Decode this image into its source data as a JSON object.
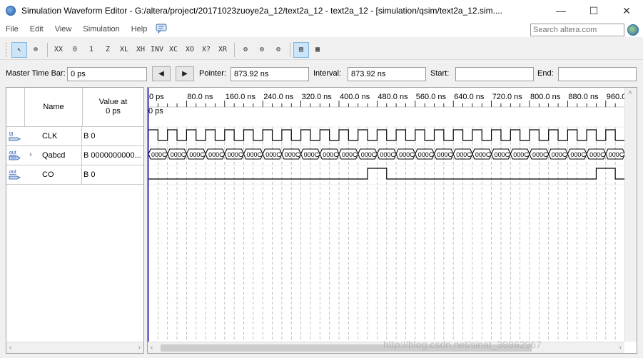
{
  "window": {
    "title": "Simulation Waveform Editor - G:/altera/project/20171023zuoye2a_12/text2a_12 - text2a_12 - [simulation/qsim/text2a_12.sim....",
    "minimize": "—",
    "maximize": "☐",
    "close": "✕"
  },
  "menu": {
    "items": [
      {
        "label": "File"
      },
      {
        "label": "Edit"
      },
      {
        "label": "View"
      },
      {
        "label": "Simulation"
      },
      {
        "label": "Help"
      }
    ],
    "help_icon": "speech-bubble-icon",
    "search_placeholder": "Search altera.com"
  },
  "toolbar": {
    "tools": [
      {
        "name": "select-tool",
        "glyph": "↖",
        "active": true
      },
      {
        "name": "zoom-tool",
        "glyph": "⊕",
        "active": false
      },
      {
        "name": "uninitialized-tool",
        "glyph": "XX",
        "active": false
      },
      {
        "name": "forcing-low-tool",
        "glyph": "0",
        "active": false
      },
      {
        "name": "forcing-high-tool",
        "glyph": "1",
        "active": false
      },
      {
        "name": "high-impedance-tool",
        "glyph": "Z",
        "active": false
      },
      {
        "name": "weak-low-tool",
        "glyph": "XL",
        "active": false
      },
      {
        "name": "weak-high-tool",
        "glyph": "XH",
        "active": false
      },
      {
        "name": "invert-tool",
        "glyph": "INV",
        "active": false
      },
      {
        "name": "count-value-tool",
        "glyph": "XC",
        "active": false
      },
      {
        "name": "clock-tool",
        "glyph": "XO",
        "active": false
      },
      {
        "name": "arbitrary-value-tool",
        "glyph": "X?",
        "active": false
      },
      {
        "name": "random-value-tool",
        "glyph": "XR",
        "active": false
      },
      {
        "name": "functional-sim-tool",
        "glyph": "⚙",
        "active": false
      },
      {
        "name": "timing-sim-tool",
        "glyph": "⚙",
        "active": false
      },
      {
        "name": "netlist-tool",
        "glyph": "⚙",
        "active": false
      },
      {
        "name": "waveform-compare-tool",
        "glyph": "▤",
        "active": true
      },
      {
        "name": "grid-snap-tool",
        "glyph": "▦",
        "active": false
      }
    ]
  },
  "timebar": {
    "master_label": "Master Time Bar:",
    "master_value": "0 ps",
    "prev_glyph": "◀",
    "next_glyph": "▶",
    "pointer_label": "Pointer:",
    "pointer_value": "873.92 ns",
    "interval_label": "Interval:",
    "interval_value": "873.92 ns",
    "start_label": "Start:",
    "start_value": "",
    "end_label": "End:",
    "end_value": ""
  },
  "signals": {
    "header_name": "Name",
    "header_value": "Value at\n0 ps",
    "rows": [
      {
        "icon": "in",
        "name": "CLK",
        "value": "B 0",
        "expandable": false
      },
      {
        "icon": "out",
        "name": "Qabcd",
        "value": "B 0000000000...",
        "expandable": true
      },
      {
        "icon": "out",
        "name": "CO",
        "value": "B 0",
        "expandable": false
      }
    ]
  },
  "waveform": {
    "time_labels": [
      "0 ps",
      "80.0 ns",
      "160.0 ns",
      "240.0 ns",
      "320.0 ns",
      "400.0 ns",
      "480.0 ns",
      "560.0 ns",
      "640.0 ns",
      "720.0 ns",
      "800.0 ns",
      "880.0 ns",
      "960.0 ns"
    ],
    "cursor_label": "0 ps",
    "bus_label": "000C",
    "clk_period_ns": 40,
    "co_pulses_ns": [
      [
        460,
        500
      ],
      [
        940,
        980
      ]
    ],
    "time_range_ns": [
      0,
      1000
    ],
    "colors": {
      "cursor": "#2a2aaa",
      "wave": "#000000",
      "grid": "#b0b0b0"
    }
  },
  "watermark": "http://blog.csdn.net/sinat_39862967"
}
